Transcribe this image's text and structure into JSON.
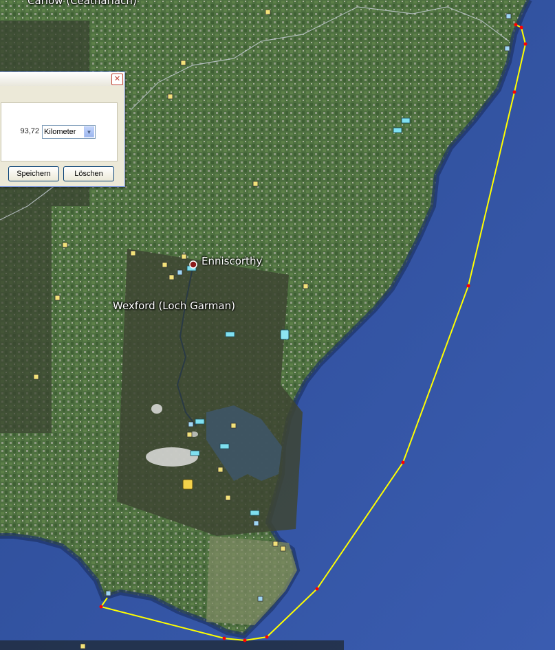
{
  "map": {
    "labels": {
      "carlow": "Carlow (Ceatharlach)",
      "enniscorthy": "Enniscorthy",
      "wexford": "Wexford (Loch Garman)"
    },
    "path_color": "#ffff00",
    "vertex_color": "#ff0000",
    "water_color": "#2a4ea0",
    "land_color": "#4b6b3c",
    "icons": [
      "small-square-marker-icon",
      "hotel-bed-icon",
      "fuel-station-icon",
      "museum-icon",
      "town-dot-icon"
    ]
  },
  "dialog": {
    "close": "✕",
    "distance_value": "93,72",
    "unit_selected": "Kilometer",
    "save_label": "Speichern",
    "delete_label": "Löschen"
  }
}
